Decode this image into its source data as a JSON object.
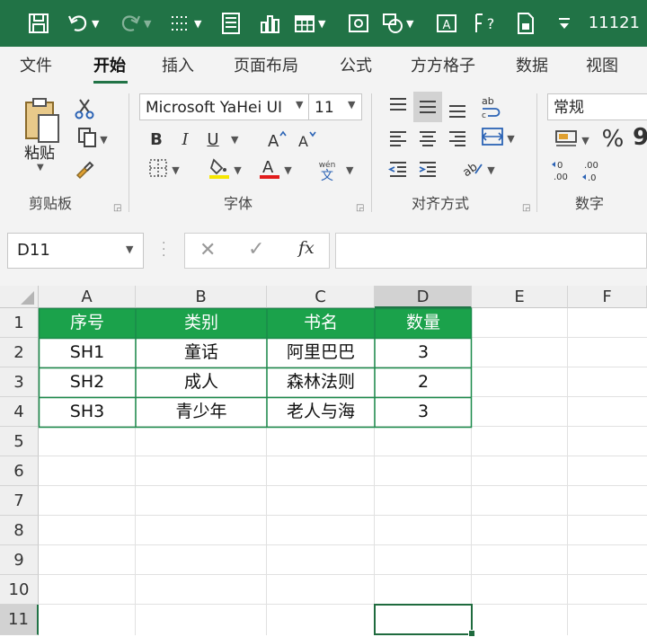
{
  "filename": "11121",
  "tabs": [
    "文件",
    "开始",
    "插入",
    "页面布局",
    "公式",
    "方方格子",
    "数据",
    "视图"
  ],
  "active_tab": "开始",
  "ribbon": {
    "clipboard": {
      "paste_label": "粘贴",
      "group_label": "剪贴板"
    },
    "font": {
      "font_name": "Microsoft YaHei UI",
      "font_size": "11",
      "bold": "B",
      "italic": "I",
      "underline": "U",
      "phonetic_top": "wén",
      "phonetic_bottom": "文",
      "group_label": "字体"
    },
    "alignment": {
      "group_label": "对齐方式"
    },
    "number": {
      "format": "常规",
      "percent": "%",
      "comma": "9",
      "group_label": "数字"
    }
  },
  "formula_bar": {
    "name_box": "D11",
    "fx_label": "fx",
    "formula": ""
  },
  "columns": [
    "A",
    "B",
    "C",
    "D",
    "E",
    "F"
  ],
  "selected_column": "D",
  "rows": [
    "1",
    "2",
    "3",
    "4",
    "5",
    "6",
    "7",
    "8",
    "9",
    "10",
    "11"
  ],
  "selected_row": "11",
  "table": {
    "headers": [
      "序号",
      "类别",
      "书名",
      "数量"
    ],
    "rows": [
      [
        "SH1",
        "童话",
        "阿里巴巴",
        "3"
      ],
      [
        "SH2",
        "成人",
        "森林法则",
        "2"
      ],
      [
        "SH3",
        "青少年",
        "老人与海",
        "3"
      ]
    ]
  },
  "colors": {
    "excel_green": "#217346",
    "header_fill": "#1ba24b",
    "table_border": "#1b8a4a"
  }
}
